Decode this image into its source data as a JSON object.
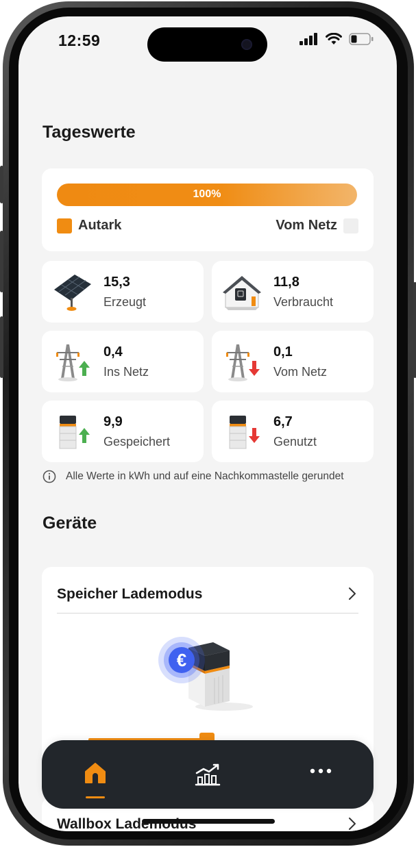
{
  "status": {
    "time": "12:59"
  },
  "daily": {
    "title": "Tageswerte",
    "progress": {
      "label": "100%",
      "percent": 100
    },
    "legend": {
      "autark": "Autark",
      "grid": "Vom Netz"
    },
    "tiles": [
      {
        "value": "15,3",
        "label": "Erzeugt"
      },
      {
        "value": "11,8",
        "label": "Verbraucht"
      },
      {
        "value": "0,4",
        "label": "Ins Netz"
      },
      {
        "value": "0,1",
        "label": "Vom Netz"
      },
      {
        "value": "9,9",
        "label": "Gespeichert"
      },
      {
        "value": "6,7",
        "label": "Genutzt"
      }
    ],
    "info": "Alle Werte in kWh und auf eine Nachkommastelle gerundet"
  },
  "devices": {
    "title": "Geräte",
    "storage_card": {
      "title": "Speicher Lademodus"
    },
    "wallbox_card": {
      "title": "Wallbox Lademodus"
    }
  },
  "nav": {
    "items": [
      "home",
      "statistics",
      "more"
    ],
    "active": "home"
  },
  "colors": {
    "accent": "#F08C12",
    "background": "#F4F4F4",
    "nav": "#22262B",
    "up_arrow": "#4CAF50",
    "down_arrow": "#E53935"
  }
}
